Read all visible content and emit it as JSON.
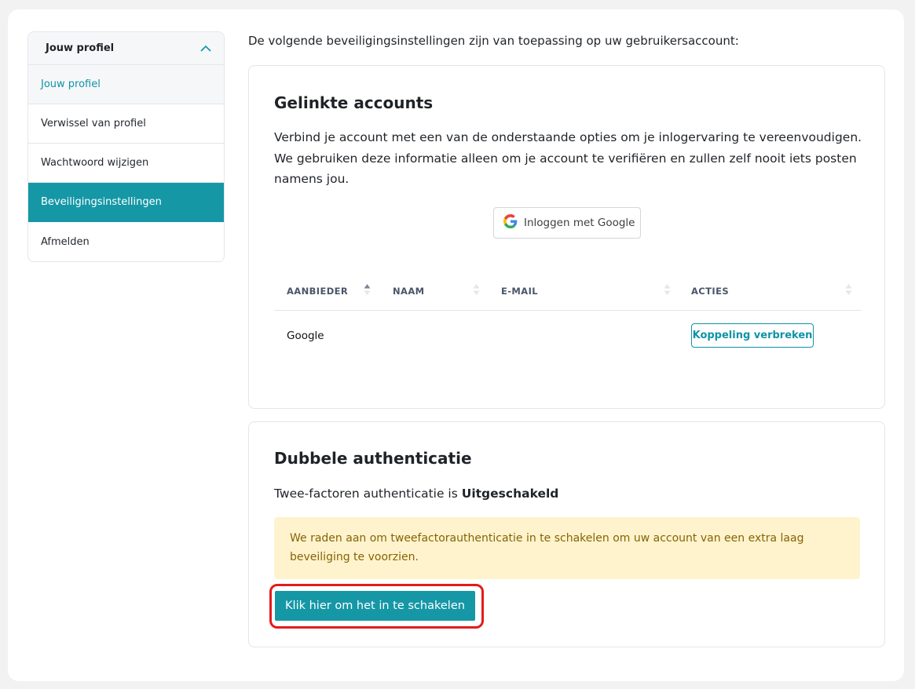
{
  "sidebar": {
    "header": "Jouw profiel",
    "items": [
      {
        "label": "Jouw profiel"
      },
      {
        "label": "Verwissel van profiel"
      },
      {
        "label": "Wachtwoord wijzigen"
      },
      {
        "label": "Beveiligingsinstellingen"
      },
      {
        "label": "Afmelden"
      }
    ]
  },
  "intro": "De volgende beveiligingsinstellingen zijn van toepassing op uw gebruikersaccount:",
  "linked": {
    "title": "Gelinkte accounts",
    "description": "Verbind je account met een van de onderstaande opties om je inlogervaring te vereenvoudigen. We gebruiken deze informatie alleen om je account te verifiëren en zullen zelf nooit iets posten namens jou.",
    "google_button": "Inloggen met Google",
    "columns": [
      "AANBIEDER",
      "NAAM",
      "E-MAIL",
      "ACTIES"
    ],
    "rows": [
      {
        "provider": "Google",
        "name": "",
        "email": "",
        "action": "Koppeling verbreken"
      }
    ]
  },
  "twofa": {
    "title": "Dubbele authenticatie",
    "status_prefix": "Twee-factoren authenticatie is ",
    "status_value": "Uitgeschakeld",
    "alert": "We raden aan om tweefactorauthenticatie in te schakelen om uw account van een extra laag beveiliging te voorzien.",
    "enable_button": "Klik hier om het in te schakelen"
  },
  "colors": {
    "accent": "#1597a6",
    "alert_bg": "#fff3cd",
    "alert_text": "#856404",
    "highlight": "#e31b1b"
  }
}
